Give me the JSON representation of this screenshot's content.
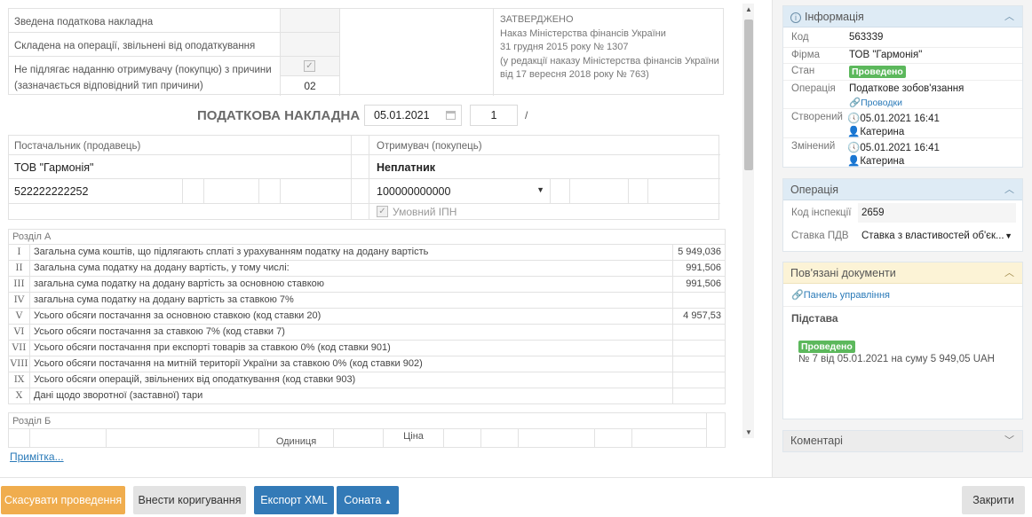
{
  "header_table": {
    "row1": "Зведена податкова накладна",
    "row2": "Складена на операції, звільнені від оподаткування",
    "row3": "Не підлягає наданню отримувачу (покупцю) з причини (зазначається відповідний тип причини)",
    "reason_code": "02",
    "approved": [
      "ЗАТВЕРДЖЕНО",
      "Наказ Міністерства фінансів України",
      "31 грудня 2015 року № 1307",
      "(у редакції наказу Міністерства фінансів України",
      "від 17 вересня 2018 року № 763)"
    ]
  },
  "title": "ПОДАТКОВА НАКЛАДНА",
  "date": "05.01.2021",
  "number": "1",
  "number_sep": "/",
  "supplier": {
    "label": "Постачальник (продавець)",
    "name": "ТОВ \"Гармонія\"",
    "ipn": "522222222252"
  },
  "buyer": {
    "label": "Отримувач (покупець)",
    "name": "Неплатник",
    "ipn": "100000000000",
    "conditional_ipn": "Умовний ІПН"
  },
  "section_a": {
    "label": "Розділ А",
    "rows": [
      {
        "n": "I",
        "d": "Загальна сума коштів, що підлягають сплаті з урахуванням податку на додану вартість",
        "v": "5 949,036"
      },
      {
        "n": "II",
        "d": "Загальна сума податку на додану вартість, у тому числі:",
        "v": "991,506"
      },
      {
        "n": "III",
        "d": "загальна сума податку на додану вартість за основною ставкою",
        "v": "991,506"
      },
      {
        "n": "IV",
        "d": "загальна сума податку на додану вартість за ставкою 7%",
        "v": ""
      },
      {
        "n": "V",
        "d": "Усього обсяги постачання за основною ставкою (код ставки 20)",
        "v": "4 957,53"
      },
      {
        "n": "VI",
        "d": "Усього обсяги постачання за ставкою 7% (код ставки 7)",
        "v": ""
      },
      {
        "n": "VII",
        "d": "Усього обсяги постачання при експорті товарів за ставкою 0% (код ставки 901)",
        "v": ""
      },
      {
        "n": "VIII",
        "d": "Усього обсяги постачання на митній території України за ставкою 0% (код ставки 902)",
        "v": ""
      },
      {
        "n": "IX",
        "d": "Усього обсяги операцій, звільнених від оподаткування (код ставки 903)",
        "v": ""
      },
      {
        "n": "X",
        "d": "Дані щодо зворотної (заставної) тари",
        "v": ""
      }
    ]
  },
  "section_b": {
    "label": "Розділ Б",
    "col_unit": "Одиниця",
    "col_price": "Ціна"
  },
  "note_link": "Примітка...",
  "info_panel": {
    "title": "Інформація",
    "code_k": "Код",
    "code_v": "563339",
    "firm_k": "Фірма",
    "firm_v": "ТОВ \"Гармонія\"",
    "state_k": "Стан",
    "state_v": "Проведено",
    "op_k": "Операція",
    "op_v": "Податкове зобов'язання",
    "op_link": "Проводки",
    "created_k": "Створений",
    "created_v": "05.01.2021 16:41",
    "created_user": "Катерина",
    "changed_k": "Змінений",
    "changed_v": "05.01.2021 16:41",
    "changed_user": "Катерина"
  },
  "op_panel": {
    "title": "Операція",
    "insp_k": "Код інспекції",
    "insp_v": "2659",
    "vat_k": "Ставка ПДВ",
    "vat_v": "Ставка з властивостей об'єк..."
  },
  "related_panel": {
    "title": "Пов'язані документи",
    "link": "Панель управління",
    "basis": "Підстава",
    "badge": "Проведено",
    "doc": "№ 7 від 05.01.2021 на суму 5 949,05 UAH"
  },
  "comments_panel": {
    "title": "Коментарі"
  },
  "buttons": {
    "cancel": "Скасувати проведення",
    "correct": "Внести коригування",
    "export": "Експорт XML",
    "sonata": "Соната",
    "close": "Закрити"
  },
  "colors": {
    "orange": "#f0ad4e",
    "blue": "#337ab7",
    "green": "#5cb85c",
    "panel_head": "#deebf5",
    "related_head": "#fcf3d6"
  }
}
